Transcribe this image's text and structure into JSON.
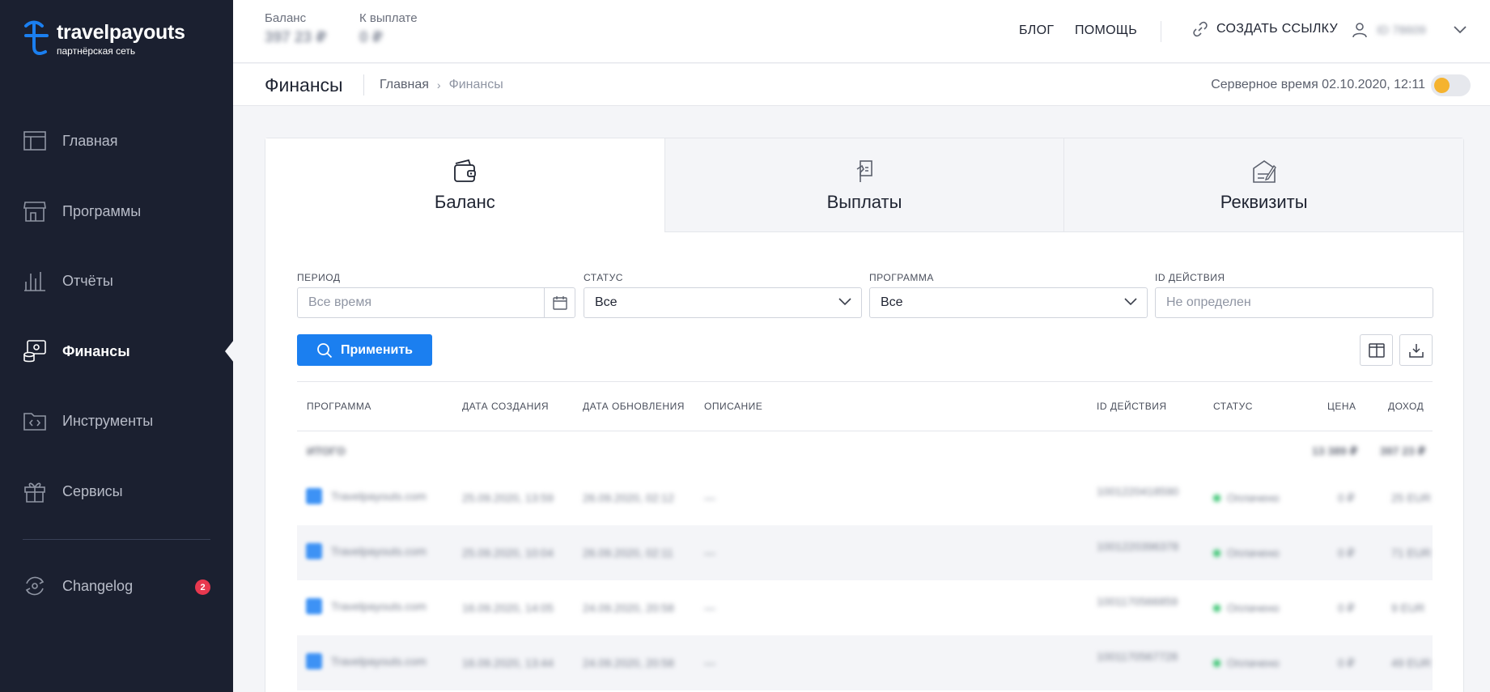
{
  "brand": {
    "name": "travelpayouts",
    "tagline": "партнёрская сеть"
  },
  "sidebar": {
    "items": [
      {
        "label": "Главная",
        "icon": "home-layout-icon"
      },
      {
        "label": "Программы",
        "icon": "store-icon"
      },
      {
        "label": "Отчёты",
        "icon": "bar-chart-icon"
      },
      {
        "label": "Финансы",
        "icon": "finance-icon",
        "active": true
      },
      {
        "label": "Инструменты",
        "icon": "code-folder-icon"
      },
      {
        "label": "Сервисы",
        "icon": "gift-icon"
      }
    ],
    "changelog": {
      "label": "Changelog",
      "badge": "2",
      "icon": "changelog-icon"
    }
  },
  "header": {
    "balance_label": "Баланс",
    "balance_value": "397 23 ₽",
    "payout_label": "К выплате",
    "payout_value": "0 ₽",
    "blog": "БЛОГ",
    "help": "ПОМОЩЬ",
    "create_link": "СОЗДАТЬ ССЫЛКУ",
    "user_id": "ID 78609"
  },
  "subheader": {
    "title": "Финансы",
    "breadcrumb": {
      "home": "Главная",
      "current": "Финансы"
    },
    "server_time": "Серверное время 02.10.2020, 12:11"
  },
  "tabs": [
    {
      "label": "Баланс",
      "active": true
    },
    {
      "label": "Выплаты"
    },
    {
      "label": "Реквизиты"
    }
  ],
  "filters": {
    "period": {
      "label": "ПЕРИОД",
      "placeholder": "Все время"
    },
    "status": {
      "label": "СТАТУС",
      "value": "Все"
    },
    "program": {
      "label": "ПРОГРАММА",
      "value": "Все"
    },
    "action_id": {
      "label": "ID ДЕЙСТВИЯ",
      "placeholder": "Не определен"
    },
    "apply": "Применить"
  },
  "table": {
    "columns": [
      "ПРОГРАММА",
      "ДАТА СОЗДАНИЯ",
      "ДАТА ОБНОВЛЕНИЯ",
      "ОПИСАНИЕ",
      "ID ДЕЙСТВИЯ",
      "СТАТУС",
      "ЦЕНА",
      "ДОХОД"
    ],
    "total": {
      "label": "ИТОГО",
      "price": "13 389 ₽",
      "income": "397 23 ₽"
    },
    "rows": [
      {
        "program": "Travelpayouts.com",
        "created": "25.09.2020, 13:59",
        "updated": "26.09.2020, 02:12",
        "description": "—",
        "action_id": "1001220418590",
        "status": "Оплачено",
        "price": "0 ₽",
        "income": "25 EUR"
      },
      {
        "program": "Travelpayouts.com",
        "created": "25.09.2020, 10:04",
        "updated": "26.09.2020, 02:11",
        "description": "—",
        "action_id": "1001220396378",
        "status": "Оплачено",
        "price": "0 ₽",
        "income": "71 EUR"
      },
      {
        "program": "Travelpayouts.com",
        "created": "16.09.2020, 14:05",
        "updated": "24.09.2020, 20:58",
        "description": "—",
        "action_id": "1001170566859",
        "status": "Оплачено",
        "price": "0 ₽",
        "income": "9 EUR"
      },
      {
        "program": "Travelpayouts.com",
        "created": "16.09.2020, 13:44",
        "updated": "24.09.2020, 20:58",
        "description": "—",
        "action_id": "1001170567728",
        "status": "Оплачено",
        "price": "0 ₽",
        "income": "49 EUR"
      }
    ]
  },
  "colors": {
    "sidebar_bg": "#1b2030",
    "accent": "#1b7ff0",
    "toggle_knob": "#f5b32f",
    "badge": "#e8384f",
    "status_ok": "#2fc16a"
  }
}
